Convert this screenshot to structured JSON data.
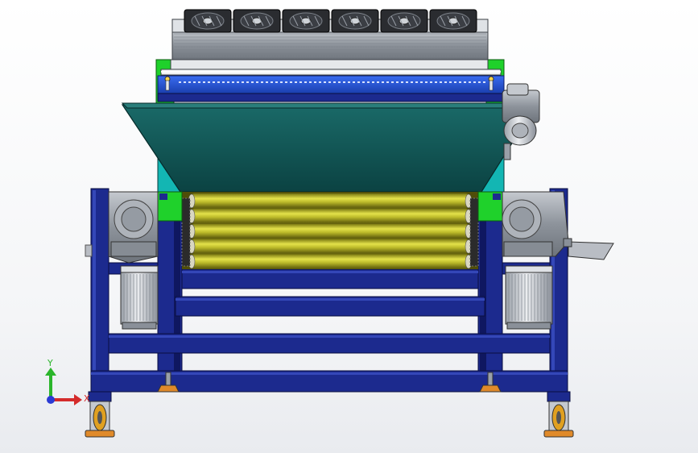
{
  "viewport": {
    "background": "#ffffff"
  },
  "model": {
    "fan_count": 6,
    "roller_count": 5,
    "colors": {
      "frame": "#1c2a8e",
      "frame_dark": "#0f1760",
      "frame_light": "#3447b8",
      "hopper": "#0d4c4c",
      "hopper_side": "#13b6b3",
      "accent_green": "#1fd12b",
      "belt_blue": "#2f5fd6",
      "roller": "#bdbb2a",
      "roller_dark": "#6d6b10",
      "motor": "#c9ccd2",
      "fan": "#2a2c30",
      "housing": "#9aa0a8",
      "pad": "#e08a2a"
    }
  },
  "axis_triad": {
    "x_label": "X",
    "y_label": "Y",
    "x_color": "#d42b2b",
    "y_color": "#2bb52b",
    "z_color": "#2b3ad4"
  }
}
